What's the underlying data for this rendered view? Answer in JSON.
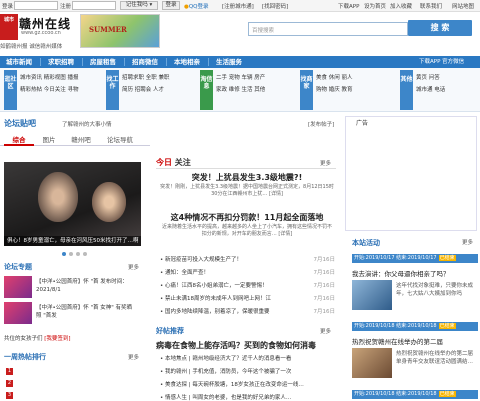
{
  "topbar": {
    "login_label": "登录",
    "register_label": "注册",
    "dropdown_value": "记住我吗",
    "login_btn": "登录",
    "qq_login": "QQ登录",
    "qq_register": "[注册城市通]",
    "forgot": "[找回密码]",
    "links": [
      "下载APP",
      "设为首页",
      "加入收藏",
      "联系我们",
      "网站地图"
    ]
  },
  "header": {
    "logo_seal": "城市",
    "logo_name": "赣州在线",
    "logo_url": "www.gz.ccoo.cn",
    "slogan": "如鹤赣州报 诚信赣州媒体",
    "banner_text": "SUMMER",
    "search_placeholder": "百搜搜索",
    "search_btn": "搜 索"
  },
  "nav": {
    "items": [
      "城市新闻",
      "求职招聘",
      "房屋租售",
      "招商微信",
      "本地相亲",
      "生活服务"
    ],
    "right": "下载APP  官方微信"
  },
  "subnav": [
    {
      "head": "逛社区",
      "color": "blue",
      "lines": [
        "城市资讯 精彩视图 播报",
        "精彩热帖 今日关注 寻物"
      ]
    },
    {
      "head": "找工作",
      "color": "blue",
      "lines": [
        "招聘求职 全职 兼职",
        "简历 招聘会 人才"
      ]
    },
    {
      "head": "淘信息",
      "color": "green",
      "lines": [
        "二手 宠物 车辆 房产",
        "家政 维修 生活 其他"
      ]
    },
    {
      "head": "找商家",
      "color": "blue",
      "lines": [
        "美食 休闲 丽人",
        "购物 婚庆 教育"
      ]
    },
    {
      "head": "其他",
      "color": "blue",
      "lines": [
        "黄页 问答",
        "城市通 电话"
      ]
    }
  ],
  "forum": {
    "title": "论坛贴吧",
    "subtitle": "了解赣州的大事小情",
    "more": "[发布帖子]",
    "tabs": [
      "综合",
      "图片",
      "赣州吧",
      "论坛导航"
    ]
  },
  "hero": {
    "caption": "俱心！8岁男童溺亡，母亲在河风压50米找打开了…啊"
  },
  "topics": {
    "title": "论坛专题",
    "more": "更多",
    "items": [
      {
        "text": "【中洋•公园首府】怀 \"首 发布时间：2021/8/1"
      },
      {
        "text": "【中洋•公园首府】怀 \"首 女神\" 有奖晒照 \"首发"
      }
    ]
  },
  "sign": {
    "text": "共位的女孩子们",
    "link": "[我要签到]"
  },
  "week": {
    "title": "一周热帖排行",
    "more": "更多",
    "ranks": [
      "1",
      "2",
      "3"
    ]
  },
  "today": {
    "head1": "今日",
    "head2": "关注",
    "more": "更多",
    "headlines": [
      {
        "title": "突发！上犹县发生3.3级地震?!",
        "summary": "突发！刚刚，上犹县发生3.3级地震！据中国地震台网正式测定，8月12日15时30分在江西赣州市上犹… [详情]"
      },
      {
        "title": "这4种情况不再扣分罚款！11月起全面落地",
        "summary": "近来随着生活水平的提高，越来越多的人坐上了小汽车，拥有这些情况不罚不扣分的新规，对开车的朋友而言… [详情]"
      }
    ],
    "list": [
      {
        "text": "新冠疫苗可投入大规模生产了！",
        "date": "7月16日"
      },
      {
        "text": "通知：全面严查！",
        "date": "7月16日"
      },
      {
        "text": "心痛！江西8名小姐弟溺亡，一定要警惕！",
        "date": "7月16日"
      },
      {
        "text": "禁止未满18周岁的未成年人到网吧上网！江",
        "date": "7月16日"
      },
      {
        "text": "国内多地陆续降温，别着凉了，保暖很重要",
        "date": "7月16日"
      }
    ]
  },
  "rec": {
    "title": "好帖推荐",
    "more": "更多",
    "head": "病毒在食物上能存活吗？买到的食物如何消毒",
    "list": [
      "本地焦点 | 赣州地级经济大了？近千人的消息看一看",
      "我的赣州 | 手机充值，消防员，今年这个被骗了一次",
      "美食达探 | 每天碗杯胶塘，18岁女孩正在改变命运一线…",
      "情感人生 | 叫周女的老婆，也是我的好兄弟的家人…"
    ]
  },
  "ad": {
    "label": "广告"
  },
  "activity": {
    "title": "本站活动",
    "more": "更多",
    "events": [
      {
        "bar": "开始:2019/10/17 结束:2019/10/17",
        "status": "已结束",
        "title": "我去演讲：你父母逼你相亲了吗？",
        "desc": "这年代找对象挺难，只要你未成年，七大姑八大姨加到你吗"
      },
      {
        "bar": "开始:2019/10/18 结束:2019/10/18",
        "status": "已结束",
        "title": "热烈祝贺赣州在线举办的第二届",
        "desc": "热烈祝贺赣州在线举办的第二届单身青年交友联谊活动圆满结…"
      },
      {
        "bar": "开始:2019/10/18 结束:2019/10/18",
        "status": "已结束",
        "title": "",
        "desc": ""
      }
    ]
  }
}
